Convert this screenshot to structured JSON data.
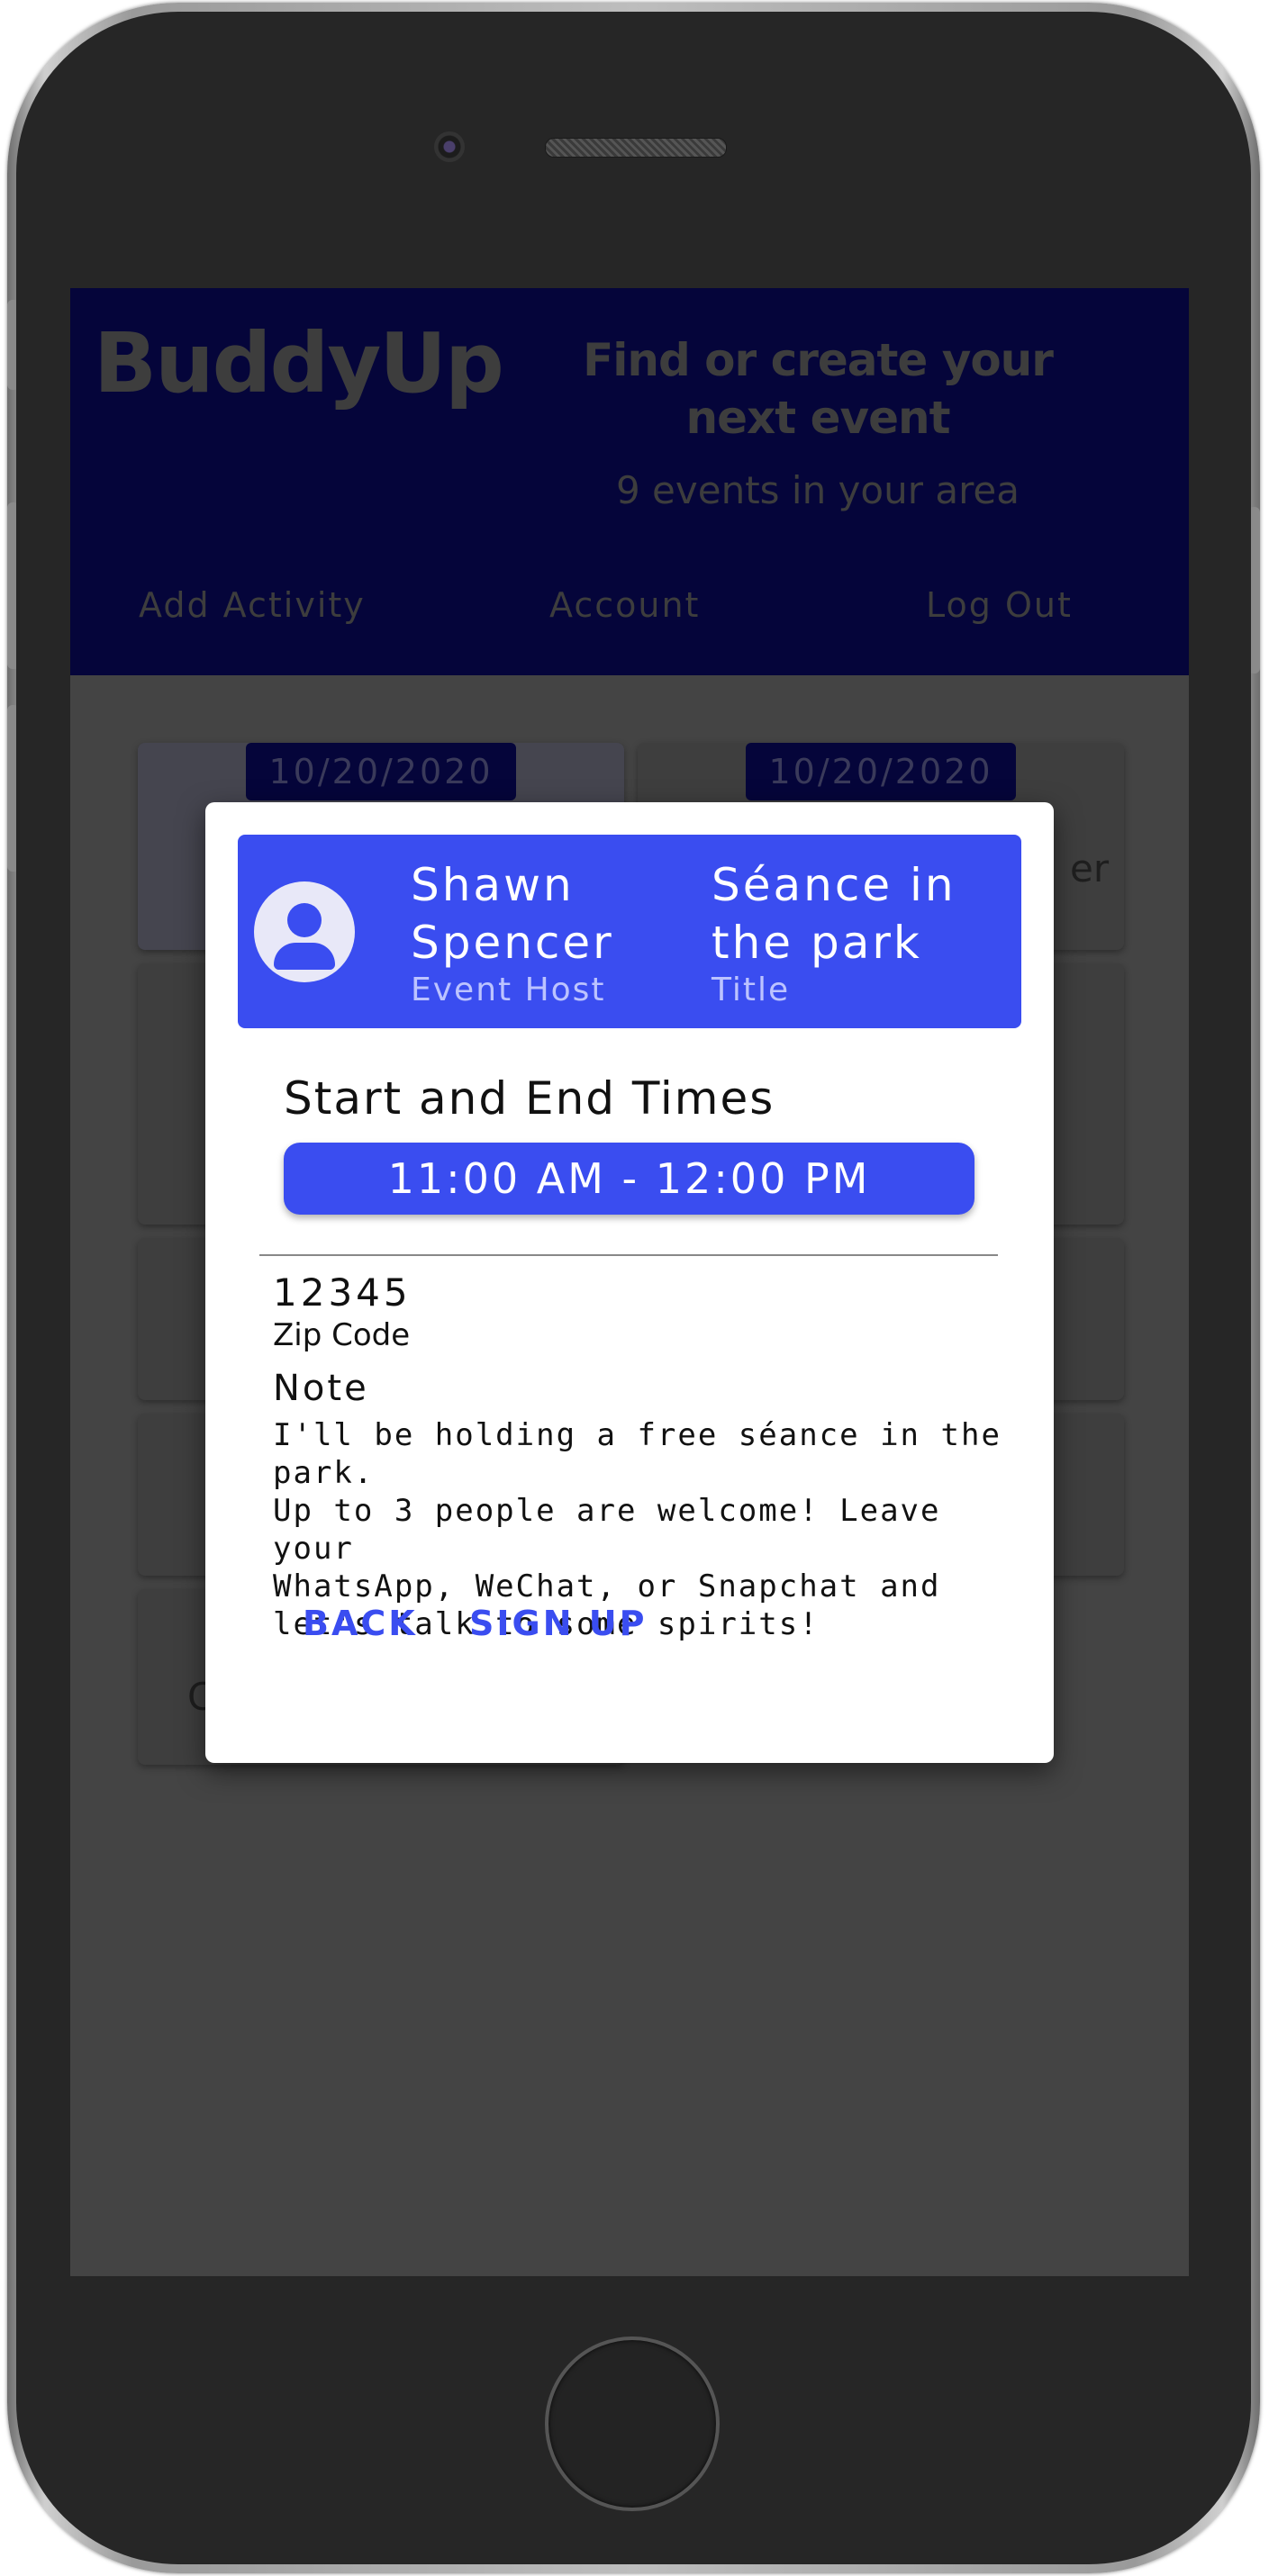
{
  "app": {
    "brand": "BuddyUp",
    "tagline": "Find or create your next event",
    "event_count": "9 events in your area"
  },
  "nav": {
    "add_activity": "Add Activity",
    "account": "Account",
    "log_out": "Log Out"
  },
  "background_cards": {
    "date_left": "10/20/2020",
    "date_right": "10/20/2020",
    "peek_right": "er",
    "peek_left": "C"
  },
  "dialog": {
    "host_name": "Shawn Spencer",
    "host_label": "Event Host",
    "event_title": "Séance in the park",
    "title_label": "Title",
    "times_heading": "Start and End Times",
    "time_range": "11:00 AM - 12:00 PM",
    "zip_code": "12345",
    "zip_label": "Zip Code",
    "note_heading": "Note",
    "note_body": "I'll be holding a free séance in the park.\nUp to 3 people are welcome! Leave your\nWhatsApp, WeChat, or Snapchat and\nlet's talk to some spirits!",
    "back_label": "BACK",
    "sign_up_label": "SIGN UP"
  },
  "colors": {
    "accent": "#3a4df0",
    "header": "#05053a"
  }
}
